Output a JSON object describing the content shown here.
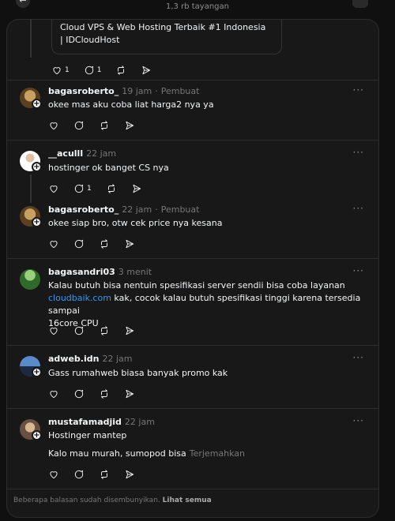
{
  "header": {
    "views": "1,3 rb tayangan"
  },
  "link_card": {
    "line1": "Cloud VPS & Web Hosting Terbaik #1 Indonesia",
    "line2": "| IDCloudHost"
  },
  "top_counts": {
    "likes": "1",
    "replies": "1"
  },
  "comments": [
    {
      "user": "bagasroberto_",
      "time": "19 jam",
      "author_tag": "Pembuat",
      "text": "okee mas aku coba liat harga2 nya ya"
    },
    {
      "user": "__aculll",
      "time": "22 jam",
      "text": "hostinger ok banget CS nya",
      "reply_count": "1"
    },
    {
      "user": "bagasroberto_",
      "time": "22 jam",
      "author_tag": "Pembuat",
      "text": "okee siap bro, otw cek price nya kesana"
    },
    {
      "user": "bagasandri03",
      "time": "3 menit",
      "text_line1": "Kalau butuh bisa nentuin spesifikasi server sendii bisa coba layanan",
      "link": "cloudbaik.com",
      "text_line2_rest": " kak, cocok kalau butuh spesifikasi tinggi karena tersedia sampai",
      "text_line3": "16core CPU"
    },
    {
      "user": "adweb.idn",
      "time": "22 jam",
      "text": "Gass rumahweb biasa banyak promo kak"
    },
    {
      "user": "mustafamadjid",
      "time": "22 jam",
      "text": "Hostinger mantep",
      "text2": "Kalo mau murah, sumopod bisa",
      "translate": "Terjemahkan"
    }
  ],
  "footer": {
    "text": "Beberapa balasan sudah disembunyikan.",
    "link": "Lihat semua"
  },
  "icons": [
    "back-arrow-icon",
    "more-icon",
    "heart-icon",
    "comment-icon",
    "repost-icon",
    "share-icon",
    "plus-icon"
  ]
}
